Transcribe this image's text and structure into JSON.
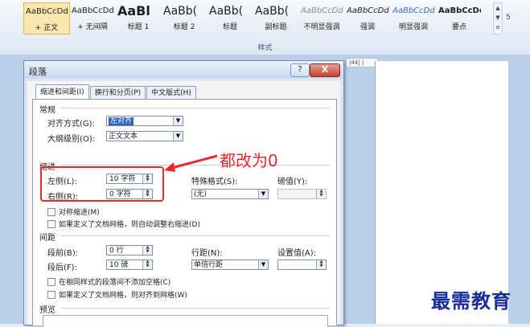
{
  "ribbon": {
    "styles": [
      {
        "sample": "AaBbCcDd",
        "name": "+ 正文",
        "selected": true
      },
      {
        "sample": "AaBbCcDd",
        "name": "+ 无间隔"
      },
      {
        "sample": "AaBl",
        "name": "标题 1",
        "bold": true,
        "size": 16
      },
      {
        "sample": "AaBb(",
        "name": "标题 2",
        "size": 14
      },
      {
        "sample": "AaBb(",
        "name": "标题",
        "size": 14
      },
      {
        "sample": "AaBb(",
        "name": "副标题",
        "size": 14
      },
      {
        "sample": "AaBbCcDd",
        "name": "不明显强调",
        "italic": true,
        "color": "#8c8c8c"
      },
      {
        "sample": "AaBbCcDd",
        "name": "强调",
        "italic": true
      },
      {
        "sample": "AaBbCcDd",
        "name": "明显强调",
        "italic": true,
        "color": "#3f6fb8"
      },
      {
        "sample": "AaBbCcDc",
        "name": "要点",
        "bold": true
      }
    ],
    "group_label": "样式",
    "launcher": "5"
  },
  "ruler_text": "|44| |",
  "dialog": {
    "title": "段落",
    "help": "?",
    "close": "X",
    "tabs": [
      {
        "label": "缩进和间距(I)",
        "active": true
      },
      {
        "label": "换行和分页(P)"
      },
      {
        "label": "中文版式(H)"
      }
    ],
    "general": {
      "heading": "常规",
      "alignment_label": "对齐方式(G):",
      "alignment_value": "左对齐",
      "outline_label": "大纲级别(O):",
      "outline_value": "正文文本"
    },
    "indent": {
      "heading": "缩进",
      "left_label": "左侧(L):",
      "left_value": "10 字符",
      "right_label": "右侧(R):",
      "right_value": "0 字符",
      "special_label": "特殊格式(S):",
      "special_value": "(无)",
      "by_label": "磅值(Y):",
      "by_value": "",
      "mirror": "对称缩进(M)",
      "auto_adjust": "如果定义了文档网格，则自动调整右缩进(D)"
    },
    "spacing": {
      "heading": "间距",
      "before_label": "段前(B):",
      "before_value": "0 行",
      "after_label": "段后(F):",
      "after_value": "10 磅",
      "line_label": "行距(N):",
      "line_value": "单倍行距",
      "at_label": "设置值(A):",
      "at_value": "",
      "no_space": "在相同样式的段落间不添加空格(C)",
      "snap_grid": "如果定义了文档网格，则对齐到网格(W)"
    },
    "preview_heading": "预览"
  },
  "annotation": "都改为0",
  "watermark": "最需教育",
  "colors": {
    "annotation": "#e8282a",
    "watermark": "#1a2c9a",
    "highlight": "#3163c3"
  }
}
